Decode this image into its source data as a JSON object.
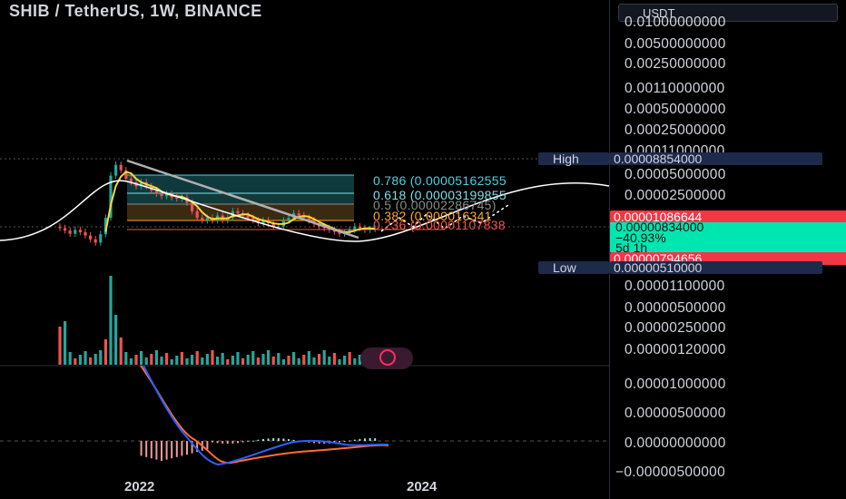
{
  "title": "SHIB / TetherUS, 1W, BINANCE",
  "currency": "USDT",
  "price_axis": {
    "ticks": [
      "0.01000000000",
      "0.00500000000",
      "0.00250000000",
      "0.00110000000",
      "0.00050000000",
      "0.00025000000",
      "0.00011000000",
      "0.00005000000",
      "0.00002500000",
      "0.00001100000",
      "0.00000500000",
      "0.00000250000",
      "0.00000120000"
    ],
    "high_label": "High",
    "high_value": "0.00008854000",
    "low_label": "Low",
    "low_value": "0.00000510000",
    "red_top": "0.00001086644",
    "current_price": "0.00000834000",
    "change": "−40.93%",
    "countdown": "5d 1h",
    "red_bottom": "0.00000794656"
  },
  "fib_labels": [
    {
      "text": "0.786 (0.00005162555",
      "color": "#4dd0e1"
    },
    {
      "text": "0.618 (0.00003199855",
      "color": "#80deea"
    },
    {
      "text": "0.5 (0.00002286745)",
      "color": "#8a8a8a"
    },
    {
      "text": "0.382 (0.000016341",
      "color": "#ffa726"
    },
    {
      "text": "0.236 (0.00001107838",
      "color": "#ef5350"
    }
  ],
  "osc_axis": {
    "ticks": [
      "0.00001000000",
      "0.00000500000",
      "0.00000000000",
      "−0.00000500000"
    ]
  },
  "time_axis": {
    "labels": [
      "2022",
      "2024"
    ]
  },
  "colors": {
    "up": "#26a69a",
    "down": "#ef5350",
    "ma": "#fdd835",
    "macd": "#2962ff",
    "signal": "#ff6d3a",
    "curve": "#ffffff",
    "trend": "#b0b0b0"
  },
  "chart_data": {
    "type": "candlestick",
    "symbol": "SHIB/USDT",
    "interval": "1W",
    "exchange": "BINANCE",
    "x_axis_labels": [
      "2022",
      "2024"
    ],
    "high": 8.854e-05,
    "low": 5.1e-06,
    "last_close": 8.34e-06,
    "change_percent": -40.93,
    "closes": [
      8.5e-06,
      7.8e-06,
      7e-06,
      8e-06,
      7.4e-06,
      6.6e-06,
      5.8e-06,
      5.2e-06,
      6.9e-06,
      1.2e-05,
      5e-05,
      7.2e-05,
      6e-05,
      4.5e-05,
      4e-05,
      3.5e-05,
      4e-05,
      3.5e-05,
      3e-05,
      2.7e-05,
      2.5e-05,
      2.7e-05,
      2.4e-05,
      2.3e-05,
      2.4e-05,
      2e-05,
      1.5e-05,
      1.2e-05,
      1.1e-05,
      1.2e-05,
      1.1e-05,
      1.3e-05,
      1.1e-05,
      1.2e-05,
      1.5e-05,
      1.4e-05,
      1.3e-05,
      1.2e-05,
      1.1e-05,
      1e-05,
      1.1e-05,
      1e-05,
      9e-06,
      9e-06,
      1.1e-05,
      1.2e-05,
      1.4e-05,
      1.3e-05,
      1.2e-05,
      1.1e-05,
      1e-05,
      9e-06,
      8.5e-06,
      8e-06,
      7.5e-06,
      7e-06,
      7.2e-06,
      8e-06,
      9e-06,
      8.5e-06,
      8e-06,
      8.2e-06,
      8.3e-06
    ],
    "fibonacci_levels": [
      {
        "level": 0.786,
        "price": 5.162555e-05
      },
      {
        "level": 0.618,
        "price": 3.199855e-05
      },
      {
        "level": 0.5,
        "price": 2.286745e-05
      },
      {
        "level": 0.382,
        "price": 1.6341e-05
      },
      {
        "level": 0.236,
        "price": 1.107838e-05
      }
    ],
    "price_ticks": [
      0.01,
      0.005,
      0.0025,
      0.0011,
      0.0005,
      0.00025,
      0.00011,
      5e-05,
      2.5e-05,
      1.1e-05,
      5e-06,
      2.5e-06,
      1.2e-06
    ],
    "oscillator_ticks": [
      1e-05,
      5e-06,
      0,
      -5e-06
    ]
  }
}
